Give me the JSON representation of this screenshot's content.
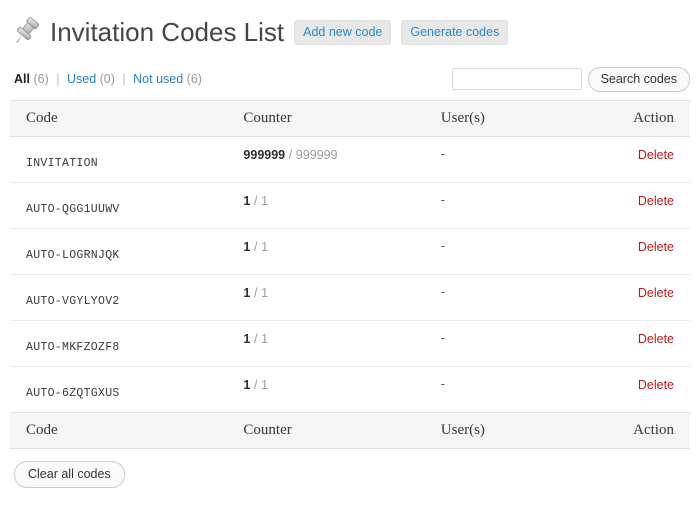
{
  "header": {
    "icon": "pushpin-icon",
    "title": "Invitation Codes List",
    "add_new_label": "Add new code",
    "generate_label": "Generate codes"
  },
  "filters": {
    "all_label": "All",
    "all_count": "(6)",
    "sep1": "|",
    "used_label": "Used",
    "used_count": "(0)",
    "sep2": "|",
    "notused_label": "Not used",
    "notused_count": "(6)"
  },
  "search": {
    "value": "",
    "placeholder": "",
    "button_label": "Search codes"
  },
  "table": {
    "columns": [
      "Code",
      "Counter",
      "User(s)",
      "Action"
    ],
    "rows": [
      {
        "code": "INVITATION",
        "used": "999999",
        "slash": "/",
        "total": "999999",
        "users": "-",
        "action": "Delete"
      },
      {
        "code": "AUTO-QGG1UUWV",
        "used": "1",
        "slash": "/",
        "total": "1",
        "users": "-",
        "action": "Delete"
      },
      {
        "code": "AUTO-LOGRNJQK",
        "used": "1",
        "slash": "/",
        "total": "1",
        "users": "-",
        "action": "Delete"
      },
      {
        "code": "AUTO-VGYLYOV2",
        "used": "1",
        "slash": "/",
        "total": "1",
        "users": "-",
        "action": "Delete"
      },
      {
        "code": "AUTO-MKFZOZF8",
        "used": "1",
        "slash": "/",
        "total": "1",
        "users": "-",
        "action": "Delete"
      },
      {
        "code": "AUTO-6ZQTGXUS",
        "used": "1",
        "slash": "/",
        "total": "1",
        "users": "-",
        "action": "Delete"
      }
    ]
  },
  "footer": {
    "clear_all_label": "Clear all codes"
  },
  "colors": {
    "link": "#2a7fc0",
    "delete": "#bb1b1b",
    "title": "#464646",
    "header_bg": "#f6f6f6"
  }
}
